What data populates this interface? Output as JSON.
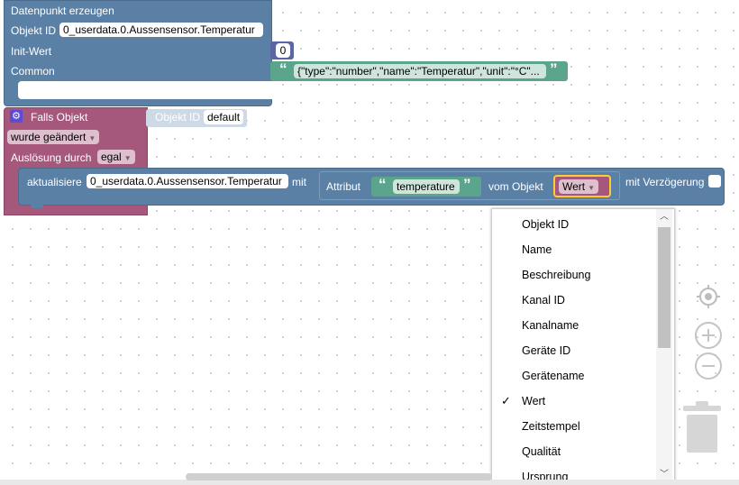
{
  "create_block": {
    "title": "Datenpunkt erzeugen",
    "object_id_label": "Objekt ID",
    "object_id_value": "0_userdata.0.Aussensensor.Temperatur",
    "init_label": "Init-Wert",
    "init_value": "0",
    "common_label": "Common",
    "common_value": "{\"type\":\"number\",\"name\":\"Temperatur\",\"unit\":\"°C\"..."
  },
  "trigger_block": {
    "title": "Falls Objekt",
    "object_id_label": "Objekt ID",
    "object_id_value": "default",
    "changed_option": "wurde geändert",
    "trigger_label": "Auslösung durch",
    "trigger_option": "egal"
  },
  "update_block": {
    "label": "aktualisiere",
    "object_value": "0_userdata.0.Aussensensor.Temperatur",
    "with_label": "mit",
    "delay_label": "mit Verzögerung",
    "attr_label": "Attribut",
    "attr_value": "temperature",
    "from_object_label": "vom Objekt",
    "selected_option": "Wert"
  },
  "dropdown": {
    "items": [
      "Objekt ID",
      "Name",
      "Beschreibung",
      "Kanal ID",
      "Kanalname",
      "Geräte ID",
      "Gerätename",
      "Wert",
      "Zeitstempel",
      "Qualität",
      "Ursprung"
    ],
    "checked": "Wert",
    "check_mark": "✓"
  },
  "colors": {
    "blue_block": "#5b80a5",
    "pink_block": "#a5577c",
    "green_text": "#5ba58c",
    "highlight": "#fc3"
  }
}
